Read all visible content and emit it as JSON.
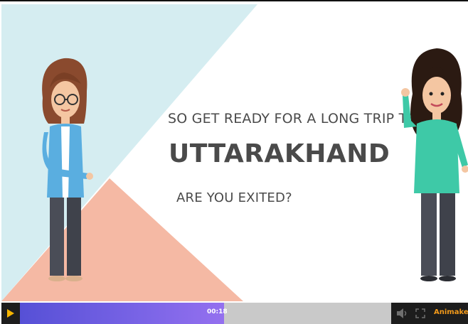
{
  "scene": {
    "line1": "SO GET READY FOR A LONG TRIP TO",
    "line2": "UTTARAKHAND",
    "line3": "ARE YOU EXITED?",
    "colors": {
      "triangle_blue": "#d5edf1",
      "triangle_peach": "#f5b9a4",
      "text": "#4a4a4a",
      "left_shirt": "#5aaee0",
      "right_shirt": "#3ec9a7"
    }
  },
  "player": {
    "time": "00:18",
    "progress": 0.55,
    "brand": "Animaker",
    "accent": "#7a64e6",
    "icons": {
      "play": "play-icon",
      "volume": "volume-icon",
      "fullscreen": "fullscreen-icon"
    }
  }
}
